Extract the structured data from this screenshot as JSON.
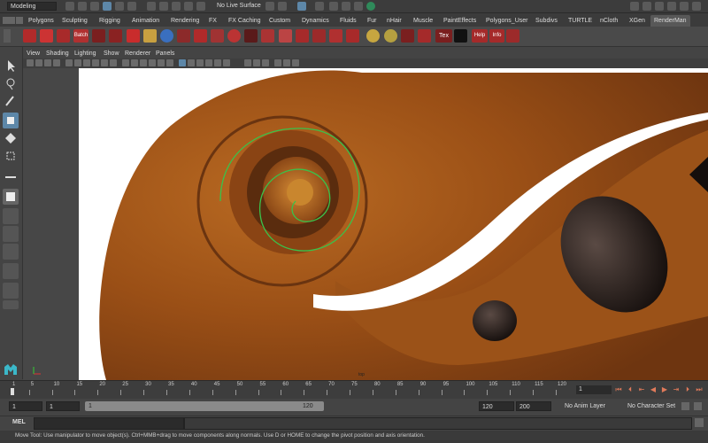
{
  "status_line": {
    "mode": "Modeling",
    "live_surface": "No Live Surface"
  },
  "shelf_tabs": [
    "Polygons",
    "Sculpting",
    "Rigging",
    "Animation",
    "Rendering",
    "FX",
    "FX Caching",
    "Custom",
    "Dynamics",
    "Fluids",
    "Fur",
    "nHair",
    "Muscle",
    "PaintEffects",
    "Polygons_User",
    "Subdivs",
    "TURTLE",
    "nCloth",
    "XGen",
    "RenderMan"
  ],
  "active_tab": "RenderMan",
  "shelf_labels": {
    "batch": "Batch",
    "tex": "Tex",
    "help": "Help",
    "info": "Info"
  },
  "panel_menu": [
    "View",
    "Shading",
    "Lighting",
    "Show",
    "Renderer",
    "Panels"
  ],
  "viewport": {
    "camera": "top"
  },
  "time_slider": {
    "ticks": [
      "1",
      "5",
      "10",
      "15",
      "20",
      "25",
      "30",
      "35",
      "40",
      "45",
      "50",
      "55",
      "60",
      "65",
      "70",
      "75",
      "80",
      "85",
      "90",
      "95",
      "100",
      "105",
      "110",
      "115",
      "120"
    ],
    "current_frame": "1"
  },
  "range_slider": {
    "start_time": "1",
    "playback_start": "1",
    "range_start": "1",
    "range_end": "120",
    "playback_end": "120",
    "end_time": "200",
    "anim_layer": "No Anim Layer",
    "character_set": "No Character Set"
  },
  "command_line": {
    "label": "MEL"
  },
  "help_line": "Move Tool: Use manipulator to move object(s). Ctrl+MMB+drag to move components along normals. Use D or HOME to change the pivot position and axis orientation.",
  "colors": {
    "ui_bg": "#444444",
    "highlight": "#5d87a8",
    "curve": "#3ac24a",
    "playback": "#e07a5a"
  }
}
